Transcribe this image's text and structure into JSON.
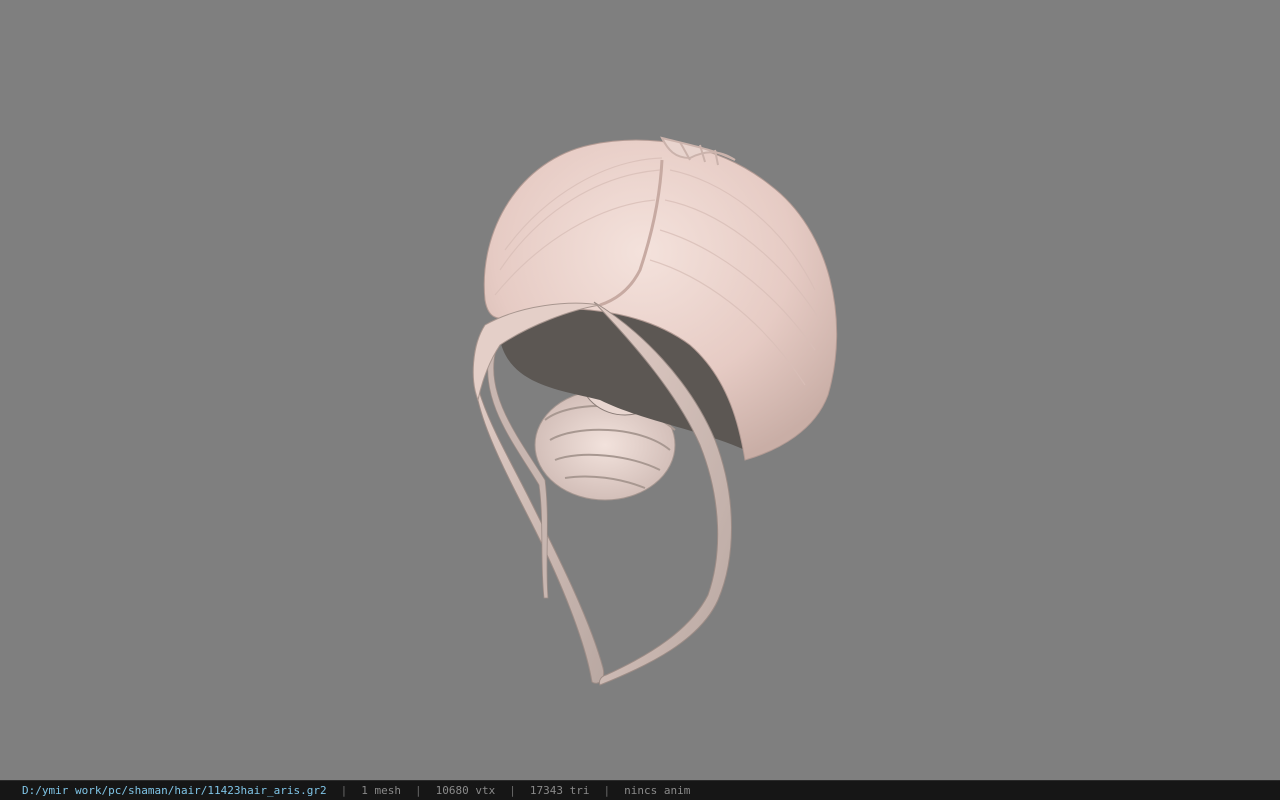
{
  "viewer": {
    "background_color": "#7f7f7f",
    "model": {
      "name": "hair-model",
      "hair_color": "#e9d2cc",
      "shadow_color": "#5a5551"
    }
  },
  "status": {
    "file_path": "D:/ymir work/pc/shaman/hair/11423hair_aris.gr2",
    "sep": "|",
    "mesh_count": "1 mesh",
    "vertex_count": "10680 vtx",
    "triangle_count": "17343 tri",
    "anim_status": "nincs anim",
    "path_color": "#7fc4e6",
    "text_color": "#8a8a8a"
  }
}
